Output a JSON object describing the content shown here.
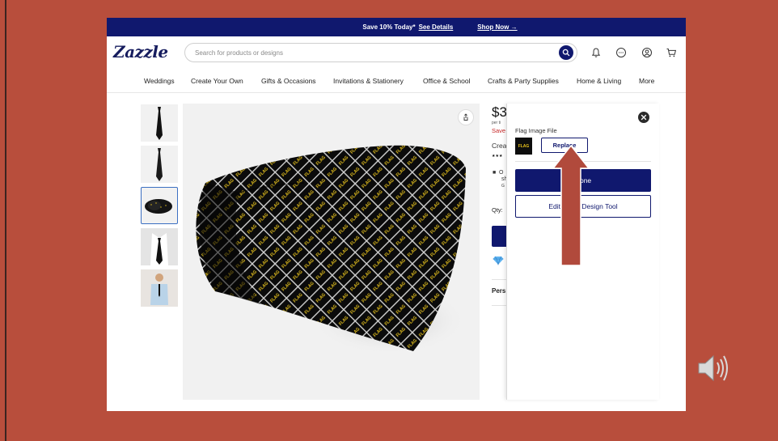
{
  "promo": {
    "text": "Save 10% Today*",
    "details_link": "See Details",
    "shop_link": "Shop Now →"
  },
  "header": {
    "logo": "Zazzle",
    "search_placeholder": "Search for products or designs",
    "icons": [
      "search-icon",
      "bell-icon",
      "chat-icon",
      "account-icon",
      "cart-icon"
    ]
  },
  "nav": {
    "items": [
      "Weddings",
      "Create Your Own",
      "Gifts & Occasions",
      "Invitations & Stationery",
      "Office & School",
      "Crafts & Party Supplies",
      "Home & Living",
      "More"
    ]
  },
  "product": {
    "price": "$3",
    "per": "per ti",
    "save": "Save",
    "creator": "Crea",
    "stars": "★★★",
    "shipping_lines": [
      "O",
      "sh",
      "G"
    ],
    "qty_label": "Qty:",
    "personalize": "Pers"
  },
  "panel": {
    "file_label": "Flag Image File",
    "thumb_text": "FLAG",
    "replace_label": "Replace",
    "done_label": "Done",
    "edit_label": "Edit Using Design Tool"
  },
  "tie": {
    "pattern_text": "FLAG"
  },
  "colors": {
    "background": "#b84e3c",
    "brand_navy": "#10186e",
    "arrow": "#b14a3c",
    "flag_yellow": "#e8c31c"
  }
}
